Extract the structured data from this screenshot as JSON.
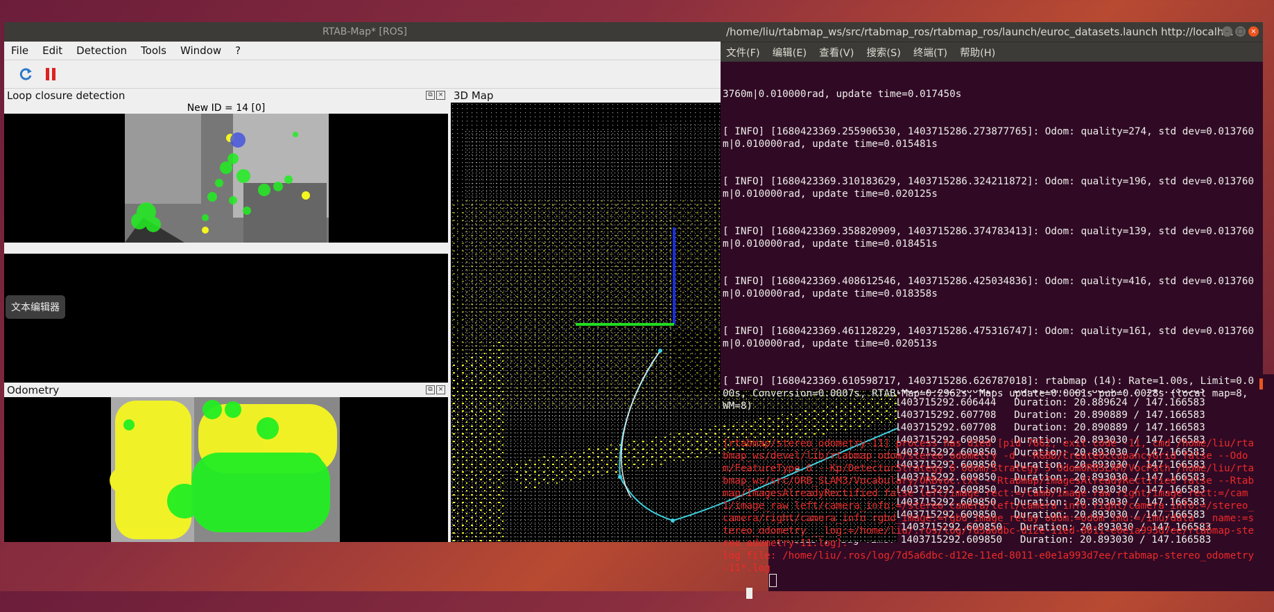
{
  "rtabmap": {
    "title": "RTAB-Map* [ROS]",
    "menu": [
      "File",
      "Edit",
      "Detection",
      "Tools",
      "Window",
      "?"
    ],
    "toolbar": {
      "refresh": "refresh-icon",
      "pause": "pause-icon"
    },
    "loop_panel": {
      "title": "Loop closure detection",
      "new_id": "New ID = 14 [0]"
    },
    "odometry_panel": {
      "title": "Odometry"
    },
    "map_panel": {
      "title": "3D Map"
    },
    "tooltip": "文本编辑器"
  },
  "terminal": {
    "title": "/home/liu/rtabmap_ws/src/rtabmap_ros/rtabmap_ros/launch/euroc_datasets.launch http://localh...",
    "menu": [
      "文件(F)",
      "编辑(E)",
      "查看(V)",
      "搜索(S)",
      "终端(T)",
      "帮助(H)"
    ],
    "lines": [
      "3760m|0.010000rad, update time=0.017450s",
      "[ INFO] [1680423369.255906530, 1403715286.273877765]: Odom: quality=274, std dev=0.013760m|0.010000rad, update time=0.015481s",
      "[ INFO] [1680423369.310183629, 1403715286.324211872]: Odom: quality=196, std dev=0.013760m|0.010000rad, update time=0.020125s",
      "[ INFO] [1680423369.358820909, 1403715286.374783413]: Odom: quality=139, std dev=0.013760m|0.010000rad, update time=0.018451s",
      "[ INFO] [1680423369.408612546, 1403715286.425034836]: Odom: quality=416, std dev=0.013760m|0.010000rad, update time=0.018358s",
      "[ INFO] [1680423369.461128229, 1403715286.475316747]: Odom: quality=161, std dev=0.013760m|0.010000rad, update time=0.020513s",
      "[ INFO] [1680423369.610598717, 1403715286.626787018]: rtabmap (14): Rate=1.00s, Limit=0.000s, Conversion=0.0007s, RTAB-Map=0.2962s, Maps update=0.0001s pub=0.0028s (local map=8, WM=8)"
    ],
    "error_text": "[rtabmap/stereo_odometry-11] process has died [pid 7662, exit code -11, cmd /home/liu/rtabmap_ws/devel/lib/rtabmap_odom/stereo_odometry -d --RGBD/CreateOccupancyGrid false --Odom/FeatureType 6 --Kp/DetectorStrategy 6 Odom/Strategy 5 OdomORBSLAM/VocPath /home/liu/rtabmap_ws/src/ORB_SLAM3/Vocabulary/ORBvoc.txt --Rtabmap/ImagesAlreadyRectified false --Rtabmap/ImagesAlreadyRectified false left/image_rect:=/cam0/image_raw right/image_rect:=/cam1/image_raw left/camera_info:=/stereo_camera/left/camera_info right/camera_info:=/stereo_camera/right/camera_info rgbd_image:=rgbd_image_relay odom:=odom imu:=/imu/data __name:=stereo_odometry __log:=/home/liu/.ros/log/7d5a6dbc-d12e-11ed-8011-e0e1a993d7ee/rtabmap-stereo_odometry-11.log].\nlog file: /home/liu/.ros/log/7d5a6dbc-d12e-11ed-8011-e0e1a993d7ee/rtabmap-stereo_odometry-11*.log"
  },
  "bag_terminal": {
    "lines": [
      "                 e: 1403715292.600417   Duration: 20.883597 / 147.166583",
      "                 e: 1403715292.606444   Duration: 20.889624 / 147.166583",
      "                 e: 1403715292.607708   Duration: 20.890889 / 147.166583",
      "                 e: 1403715292.607708   Duration: 20.890889 / 147.166583",
      "                 e: 1403715292.609850   Duration: 20.893030 / 147.166583",
      "                 e: 1403715292.609850   Duration: 20.893030 / 147.166583",
      "                 e: 1403715292.609850   Duration: 20.893030 / 147.166583",
      "                 e: 1403715292.609850   Duration: 20.893030 / 147.166583",
      "                 e: 1403715292.609850   Duration: 20.893030 / 147.166583",
      "                 e: 1403715292.609850   Duration: 20.893030 / 147.166583",
      "                 e: 1403715292.609850   Duration: 20.893030 / 147.166583",
      "[PAUSED ]  Bag Time: 1403715292.609850   Duration: 20.893030 / 147.166583",
      "[PAUSED ]  Bag Time: 1403715292.609850   Duration: 20.893030 / 147.166583"
    ]
  },
  "colors": {
    "term_bg": "#300a24",
    "error": "#ef2929",
    "titlebar": "#3c3b37",
    "ubuntu_orange": "#e95420"
  }
}
